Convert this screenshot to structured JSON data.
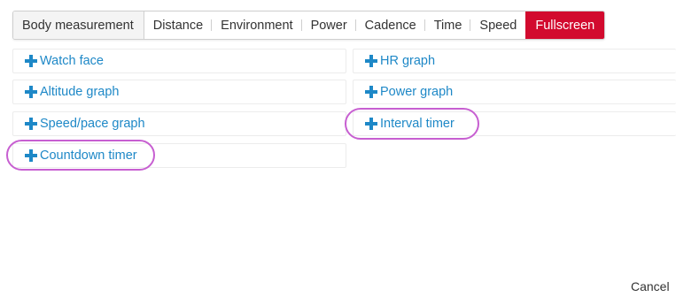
{
  "tabs": [
    {
      "label": "Body measurement"
    },
    {
      "label": "Distance"
    },
    {
      "label": "Environment"
    },
    {
      "label": "Power"
    },
    {
      "label": "Cadence"
    },
    {
      "label": "Time"
    },
    {
      "label": "Speed"
    },
    {
      "label": "Fullscreen",
      "active": true
    }
  ],
  "options": {
    "left": [
      {
        "label": "Watch face"
      },
      {
        "label": "Altitude graph"
      },
      {
        "label": "Speed/pace graph"
      },
      {
        "label": "Countdown timer",
        "highlighted": true
      }
    ],
    "right": [
      {
        "label": "HR graph"
      },
      {
        "label": "Power graph"
      },
      {
        "label": "Interval timer",
        "highlighted": true
      }
    ]
  },
  "footer": {
    "cancel_label": "Cancel"
  },
  "colors": {
    "active_tab": "#d20a2e",
    "link": "#1e88c7",
    "highlight": "#c75fd1"
  },
  "icons": {
    "add": "plus-icon"
  }
}
